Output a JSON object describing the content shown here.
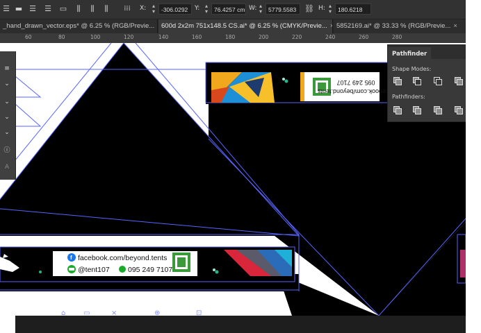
{
  "control_bar": {
    "x_label": "X:",
    "x_value": "-306.0292 cm",
    "y_label": "Y:",
    "y_value": "76.4257 cm",
    "w_label": "W:",
    "w_value": "5779.5583 c",
    "h_label": "H:",
    "h_value": "180.6218 cm"
  },
  "tabs": [
    {
      "label": "_hand_drawn_vector.eps* @ 6.25 % (RGB/Previe..."
    },
    {
      "label": "600d 2x2m 751x148.5  CS.ai* @ 6.25 % (CMYK/Previe..."
    },
    {
      "label": "5852169.ai* @ 33.33 % (RGB/Previe..."
    }
  ],
  "ruler": {
    "ticks": [
      "60",
      "80",
      "100",
      "120",
      "140",
      "160",
      "180",
      "200",
      "220",
      "240",
      "260",
      "280"
    ]
  },
  "pathfinder": {
    "title": "Pathfinder",
    "shape_modes_label": "Shape Modes:",
    "pathfinders_label": "Pathfinders:"
  },
  "banner_bottom": {
    "facebook": "facebook.com/beyond.tents",
    "line_handle": "@tent107",
    "phone": "095 249 7107"
  },
  "banner_top": {
    "facebook": "facebook.com/beyond.tents",
    "phone": "095 249 7107"
  },
  "colors": {
    "selection": "#5864ff",
    "ui_dark": "#2b2b2b",
    "facebook": "#1877f2",
    "line_green": "#1aab2b",
    "qr_green": "#3a9a3a"
  }
}
